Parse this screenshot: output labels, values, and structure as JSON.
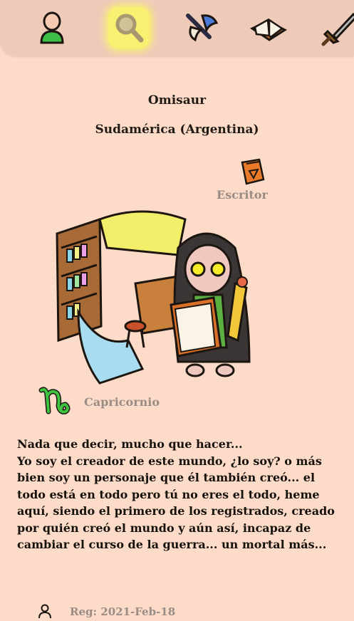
{
  "nav": {
    "items": [
      {
        "name": "profile",
        "icon": "profile-icon"
      },
      {
        "name": "search",
        "icon": "magnifier-icon",
        "active": true
      },
      {
        "name": "battle",
        "icon": "axe-icon"
      },
      {
        "name": "book",
        "icon": "open-book-icon"
      },
      {
        "name": "weapon",
        "icon": "sword-icon"
      }
    ]
  },
  "profile": {
    "name": "Omisaur",
    "region": "Sudamérica (Argentina)",
    "class_label": "Escritor",
    "class_icon": "book-shield-icon",
    "zodiac_label": "Capricornio",
    "zodiac_icon": "capricorn-icon"
  },
  "bio": {
    "lines": [
      "Nada que decir, mucho que hacer...",
      "Yo soy el creador de este mundo, ¿lo soy? o más",
      "bien soy un personaje que él también creó... el",
      "todo está en todo pero tú no eres el todo, heme",
      "aquí, siendo el primero de los registrados, creado",
      "por quién creó el mundo y aún así, incapaz de",
      "cambiar el curso de la guerra... un mortal más..."
    ]
  },
  "footer": {
    "text": "Reg: 2021-Feb-18",
    "icon": "person-icon"
  },
  "colors": {
    "background": "#fcdcc9",
    "topbar": "#eecbb9",
    "active_highlight": "#f8f070",
    "muted_text": "#9a8c84"
  }
}
